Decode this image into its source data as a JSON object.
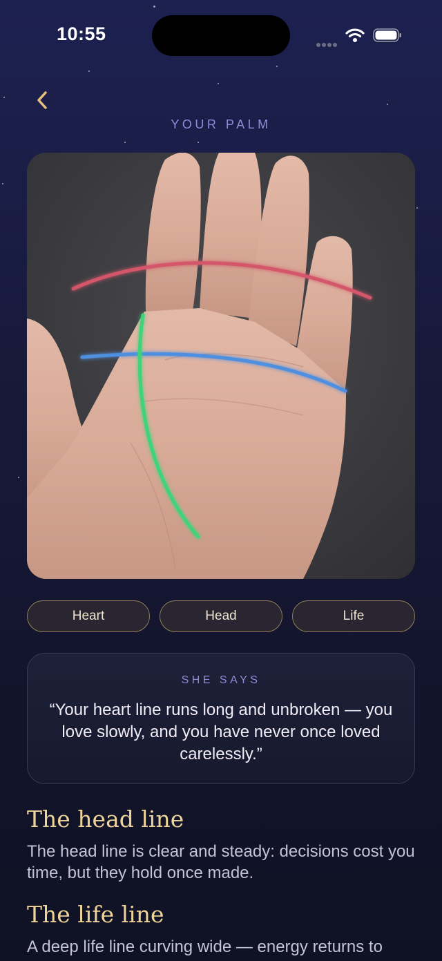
{
  "status_bar": {
    "time": "10:55"
  },
  "header": {
    "title": "YOUR PALM"
  },
  "line_colors": {
    "heart": "#d4566a",
    "head": "#4f8fe0",
    "life": "#3fd37a"
  },
  "line_tabs": [
    "Heart",
    "Head",
    "Life"
  ],
  "reading": {
    "label": "SHE SAYS",
    "quote": "“Your heart line runs long and unbroken — you love slowly, and you have never once loved carelessly.”"
  },
  "sections": [
    {
      "title": "The head line",
      "text": "The head line is clear and steady: decisions cost you time, but they hold once made."
    },
    {
      "title": "The life line",
      "text": "A deep life line curving wide — energy returns to"
    }
  ],
  "icons": {
    "back": "chevron-left-icon",
    "wifi": "wifi-icon",
    "battery": "battery-icon",
    "signal": "cellular-signal-icon"
  }
}
